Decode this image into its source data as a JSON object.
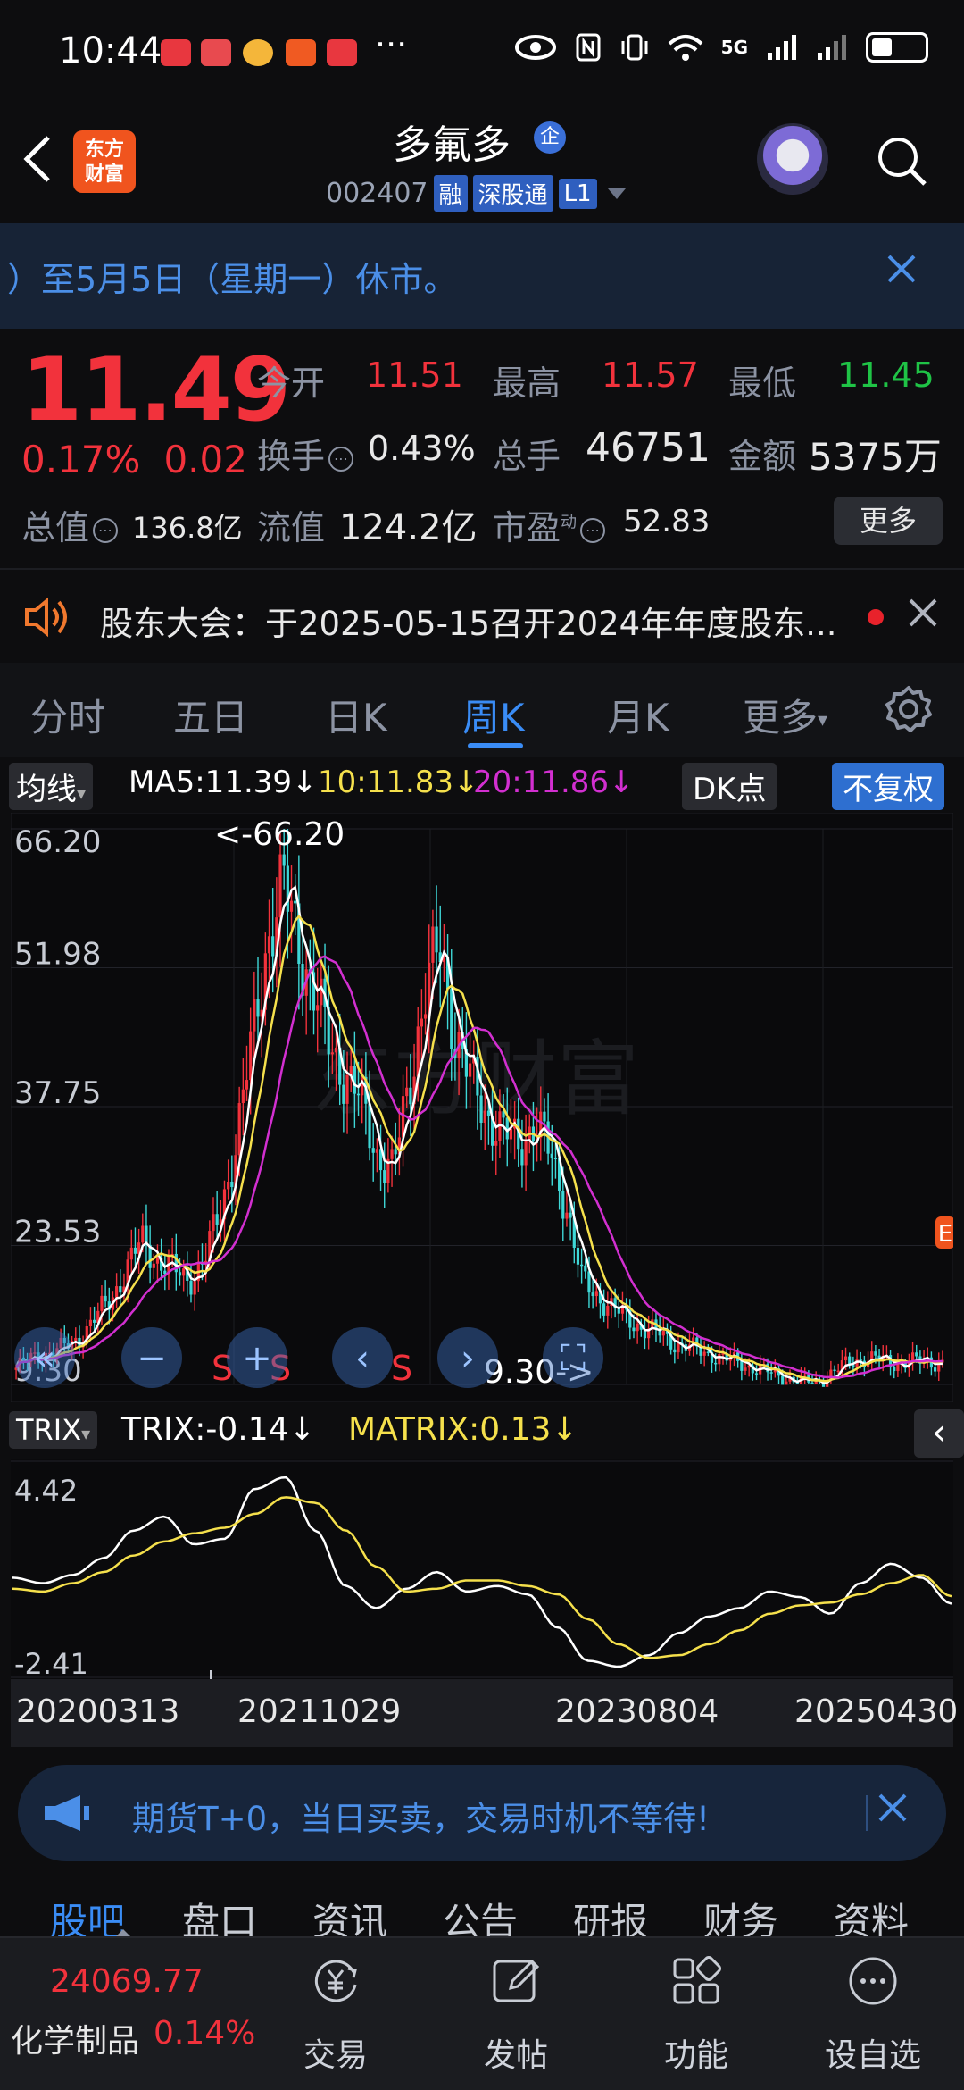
{
  "status_bar": {
    "time": "10:44",
    "app_icon_colors": [
      "#e8373f",
      "#e84a4f",
      "#f4b63a",
      "#f05a22",
      "#e8373f"
    ],
    "more": "···",
    "network": "5G",
    "indicators": [
      "eye-icon",
      "nfc-icon",
      "vibrate-icon",
      "wifi-icon",
      "signal-5g-icon",
      "signal-icon",
      "battery-icon"
    ]
  },
  "header": {
    "logo_line1": "东方",
    "logo_line2": "财富",
    "stock_name": "多氟多",
    "qy_badge": "企",
    "code": "002407",
    "tags": [
      "融",
      "深股通",
      "L1"
    ]
  },
  "notice": {
    "text": "）至5月5日（星期一）休市。"
  },
  "quote": {
    "price": "11.49",
    "change_pct": "0.17%",
    "change_abs": "0.02",
    "open_label": "今开",
    "open": "11.51",
    "high_label": "最高",
    "high": "11.57",
    "low_label": "最低",
    "low": "11.45",
    "turnover_label": "换手",
    "turnover": "0.43%",
    "volume_label": "总手",
    "volume": "46751",
    "amount_label": "金额",
    "amount": "5375万",
    "mcap_label": "总值",
    "mcap": "136.8亿",
    "float_label": "流值",
    "float": "124.2亿",
    "pe_label": "市盈",
    "pe_sup": "动",
    "pe": "52.83",
    "more": "更多",
    "info_glyph": "⋯"
  },
  "meeting": {
    "text": "股东大会：于2025-05-15召开2024年年度股东..."
  },
  "tabs": [
    "分时",
    "五日",
    "日K",
    "周K",
    "月K",
    "更多"
  ],
  "active_tab": "周K",
  "ma_legend": {
    "chip": "均线",
    "ma5": "MA5:11.39↓",
    "ma10": "10:11.83↓",
    "ma20": "20:11.86↓",
    "dk": "DK点",
    "fq": "不复权"
  },
  "kline": {
    "y_labels": [
      "66.20",
      "51.98",
      "37.75",
      "23.53",
      "9.30"
    ],
    "max_label": "<-66.20",
    "min_label": "9.30->",
    "s_markers": [
      "S",
      "S",
      "S"
    ],
    "watermark": "东方财富",
    "e_marker": "E"
  },
  "trix": {
    "chip": "TRIX",
    "trix_value": "TRIX:-0.14↓",
    "matrix_value": "MATRIX:0.13↓",
    "y_labels": [
      "4.42",
      "-2.41"
    ],
    "collapse": "‹"
  },
  "dates": [
    "20200313",
    "20211029",
    "20230804",
    "20250430"
  ],
  "colors": {
    "up": "#f2323c",
    "down": "#1fc346",
    "accent": "#3a8cf5",
    "ma5": "#ffffff",
    "ma10": "#f5e04c",
    "ma20": "#d22fd0",
    "candle_down": "#3fd7d7"
  },
  "chart_data": [
    {
      "type": "candlestick",
      "title": "",
      "y_range": [
        9.3,
        66.2
      ],
      "x_range_labels": [
        "20200313",
        "20211029",
        "20230804",
        "20250430"
      ],
      "highlights": {
        "max": 66.2,
        "min": 9.3
      },
      "series": [
        {
          "name": "MA5",
          "last": 11.39
        },
        {
          "name": "MA10",
          "last": 11.83
        },
        {
          "name": "MA20",
          "last": 11.86
        }
      ],
      "close_path": [
        11,
        12,
        12.5,
        13,
        14,
        16,
        18,
        21,
        24,
        22,
        21,
        20,
        22,
        27,
        34,
        44,
        55,
        60,
        55,
        49,
        44,
        41,
        38,
        33,
        31,
        40,
        49,
        54,
        45,
        40,
        37,
        35,
        34,
        36,
        33,
        28,
        20,
        18.5,
        17,
        16,
        15,
        14.5,
        13.5,
        13,
        12.5,
        12,
        11.5,
        11,
        10.5,
        10,
        9.6,
        9.5,
        10.5,
        11.5,
        12,
        11.8,
        11.5,
        11.6,
        11.7,
        11.49
      ]
    },
    {
      "type": "line",
      "title": "",
      "y_range": [
        -2.41,
        4.42
      ],
      "series": [
        {
          "name": "TRIX",
          "last": -0.14,
          "values": [
            0.8,
            0.6,
            0.9,
            1.5,
            2.5,
            3.0,
            2.0,
            2.2,
            4.0,
            4.42,
            2.5,
            0.5,
            -0.3,
            0.4,
            1.0,
            0.3,
            0.5,
            0.2,
            -1.0,
            -2.2,
            -2.41,
            -2.0,
            -1.2,
            -0.6,
            -0.3,
            0.3,
            0.1,
            -0.5,
            0.6,
            1.3,
            0.8,
            -0.14
          ]
        },
        {
          "name": "MATRIX",
          "last": 0.13,
          "values": [
            0.4,
            0.3,
            0.6,
            1.0,
            1.6,
            2.1,
            2.4,
            2.6,
            3.1,
            3.7,
            3.5,
            2.5,
            1.2,
            0.3,
            0.4,
            0.7,
            0.7,
            0.5,
            0.2,
            -0.7,
            -1.6,
            -2.1,
            -2.0,
            -1.6,
            -1.1,
            -0.5,
            -0.2,
            -0.1,
            0.2,
            0.6,
            0.9,
            0.13
          ]
        }
      ]
    }
  ],
  "promo": {
    "text": "期货T+0，当日买卖，交易时机不等待!"
  },
  "lower_tabs": [
    "股吧",
    "盘口",
    "资讯",
    "公告",
    "研报",
    "财务",
    "资料"
  ],
  "active_lower_tab": "股吧",
  "bottom_bar": {
    "index_value": "24069.77",
    "index_name": "化学制品",
    "index_pct": "0.14%",
    "items": [
      "交易",
      "发帖",
      "功能",
      "设自选"
    ]
  }
}
